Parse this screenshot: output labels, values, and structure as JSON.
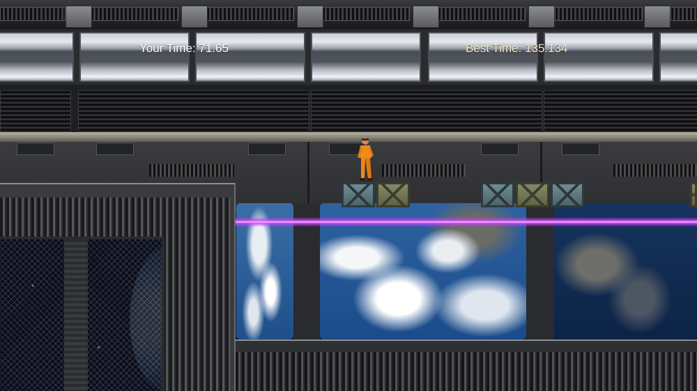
{
  "hud": {
    "your_time_label": "Your Time:",
    "your_time_value": "71.65",
    "best_time_label": "Best Time:",
    "best_time_value": "135.134"
  },
  "colors": {
    "laser": "#d23cff",
    "player_suit": "#f08a1c",
    "hud_text": "#ffffff",
    "best_text": "#f2e6c9"
  },
  "icons": {
    "player": "player-character-icon",
    "crate": "crate-icon"
  }
}
